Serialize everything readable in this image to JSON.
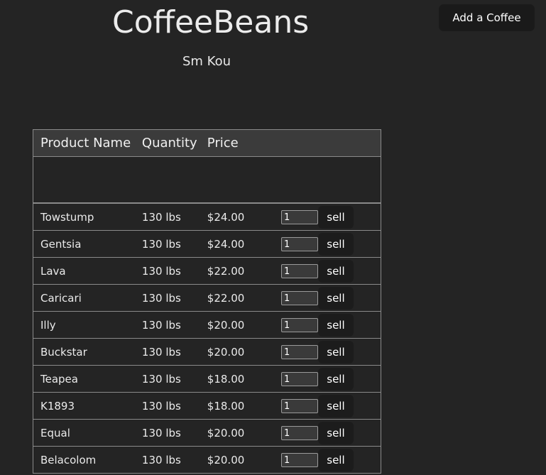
{
  "header": {
    "title": "CoffeeBeans",
    "subtitle": "Sm Kou",
    "add_button": "Add a Coffee"
  },
  "table": {
    "columns": [
      "Product Name",
      "Quantity",
      "Price"
    ],
    "sell_label": "sell",
    "rows": [
      {
        "name": "Towstump",
        "quantity": "130 lbs",
        "price": "$24.00",
        "sell_qty": "1"
      },
      {
        "name": "Gentsia",
        "quantity": "130 lbs",
        "price": "$24.00",
        "sell_qty": "1"
      },
      {
        "name": "Lava",
        "quantity": "130 lbs",
        "price": "$22.00",
        "sell_qty": "1"
      },
      {
        "name": "Caricari",
        "quantity": "130 lbs",
        "price": "$22.00",
        "sell_qty": "1"
      },
      {
        "name": "Illy",
        "quantity": "130 lbs",
        "price": "$20.00",
        "sell_qty": "1"
      },
      {
        "name": "Buckstar",
        "quantity": "130 lbs",
        "price": "$20.00",
        "sell_qty": "1"
      },
      {
        "name": "Teapea",
        "quantity": "130 lbs",
        "price": "$18.00",
        "sell_qty": "1"
      },
      {
        "name": "K1893",
        "quantity": "130 lbs",
        "price": "$18.00",
        "sell_qty": "1"
      },
      {
        "name": "Equal",
        "quantity": "130 lbs",
        "price": "$20.00",
        "sell_qty": "1"
      },
      {
        "name": "Belacolom",
        "quantity": "130 lbs",
        "price": "$20.00",
        "sell_qty": "1"
      }
    ]
  },
  "colors": {
    "background": "#242424",
    "header_row": "#3b3b3b",
    "button": "#1a1a1a",
    "border": "#8a8a8a"
  }
}
